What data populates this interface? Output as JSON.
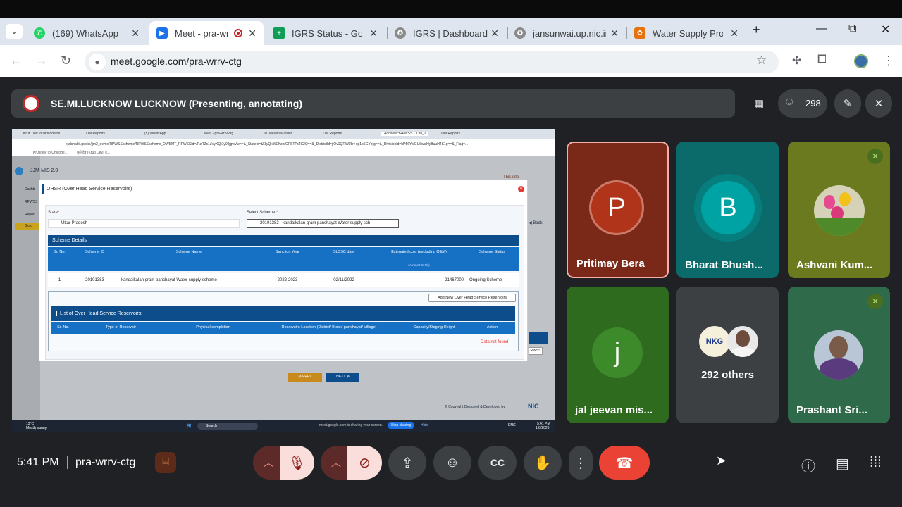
{
  "browser": {
    "tabs": [
      {
        "title": "(169) WhatsApp",
        "icon": "whatsapp-icon",
        "color": "#25d366"
      },
      {
        "title": "Meet - pra-wrr",
        "icon": "meet-icon",
        "color": "#1a73e8"
      },
      {
        "title": "IGRS Status - Goo",
        "icon": "sheets-icon",
        "color": "#0f9d58"
      },
      {
        "title": "IGRS | Dashboard",
        "icon": "emblem-icon",
        "color": "#6d6d6d"
      },
      {
        "title": "jansunwai.up.nic.in",
        "icon": "emblem-icon",
        "color": "#6d6d6d"
      },
      {
        "title": "Water Supply Proje",
        "icon": "site-icon",
        "color": "#e8710a"
      }
    ],
    "url": "meet.google.com/pra-wrrv-ctg"
  },
  "meet": {
    "presenter_banner": "SE.MI.LUCKNOW LUCKNOW (Presenting, annotating)",
    "participant_count": "298",
    "time": "5:41 PM",
    "meeting_code": "pra-wrrv-ctg",
    "others_label": "292 others"
  },
  "participants": [
    {
      "name": "Pritimay Bera",
      "initial": "P",
      "bg": "#7a2817",
      "avatar": "#b0341a",
      "highlight": true
    },
    {
      "name": "Bharat Bhush...",
      "initial": "B",
      "bg": "#0b6b6b",
      "avatar": "#00a3a3"
    },
    {
      "name": "Ashvani Kum...",
      "initial": "",
      "bg": "#6b7a1e",
      "muted": true
    },
    {
      "name": "jal jeevan mis...",
      "initial": "j",
      "bg": "#2e6b1f",
      "avatar": "#3d8a2a"
    },
    {
      "name": "Prashant Sri...",
      "initial": "",
      "bg": "#2f6b4a",
      "muted": true
    }
  ],
  "shared_screen": {
    "inner_tabs": [
      "Kruti Dev to Unicode Hi...",
      "JJM Reports",
      "(5) WhatsApp",
      "Meet - pra-wrrv-ctg",
      "Jal Jeevan Mission",
      "JJM Reports",
      "AddselectRPWSS - JJM_2",
      "JJM Reports"
    ],
    "inner_url": "ejalshakti.gov.in/jjm2_demo/RPWSSscheme/RPWSSscheme_DWSMT_RPWSSId=/RzRZc1zVyXQt7y09jgwVw==&_StateId=tZ1yQkWEKzorOFSTPrZC2Q==&_DistrictId=jiOv1QRW95r+op1p6GYbtg==&_DivisionId=bP56YVGU6wslHyBuuH4S1g==&_Flag=...",
    "inner_bookmarks": [
      "Krutidev To Unicode...",
      "कृतिदेव (Kruti Dev) द..."
    ],
    "app_name": "JJM-MIS 2.0",
    "sidebar_items": [
      "Dashb",
      "RPWSS",
      "Report",
      "Goto"
    ],
    "modal_title": "OHSR (Over Head Service Reservoirs)",
    "state_label": "State",
    "state_value": "Uttar Pradesh",
    "scheme_label": "Select Scheme",
    "scheme_value": "20101383 - kandaikalan gram panchayat Water supply sch",
    "scheme_details_title": "Scheme Details",
    "scheme_columns": [
      "Sr. No.",
      "Scheme ID",
      "Scheme Name",
      "Sanction Year",
      "SLSSC date",
      "Estimated cost (excluding O&M)",
      "Scheme Status"
    ],
    "amount_note": "(Amount In Rs)",
    "scheme_row": [
      "1",
      "20101383",
      "kandaikalan gram panchayat Water supply scheme",
      "2022-2023",
      "02/11/2022",
      "21467000",
      "Ongoing Scheme"
    ],
    "add_button": "Add New Over Head Service Reservoirs",
    "list_title": "List of Over Head Service Reservoirs:",
    "list_columns": [
      "Sr. No.",
      "Type of Reservoir",
      "Physical completion",
      "Reservoirs Location (District/ Block/ panchayat/ Village)",
      "Capacity/Staging Height",
      "Action"
    ],
    "no_data": "Data not found",
    "back": "Back",
    "this_site": "This site",
    "prev": "PREV",
    "next": "NEXT",
    "rpwss_btn": "RWSS",
    "copyright": "© Copyright Designed & Developed by",
    "nic": "NIC",
    "weather": "13°C",
    "weather_desc": "Mostly sunny",
    "taskbar_search": "Search",
    "sharing_msg": "meet.google.com is sharing your screen.",
    "stop_sharing": "Stop sharing",
    "hide": "Hide",
    "tray_lang": "ENG",
    "tray_time": "5:41 PM",
    "tray_date": "1/8/2026"
  }
}
